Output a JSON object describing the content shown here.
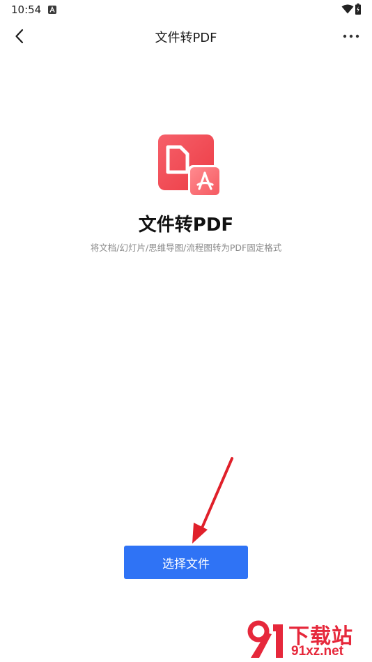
{
  "status_bar": {
    "time": "10:54"
  },
  "app_bar": {
    "title": "文件转PDF"
  },
  "hero": {
    "title": "文件转PDF",
    "subtitle": "将文档/幻灯片/思维导图/流程图转为PDF固定格式"
  },
  "actions": {
    "select_file_label": "选择文件"
  },
  "watermark": {
    "title": "下载站",
    "domain": "91xz.net"
  },
  "colors": {
    "accent": "#2f73f5",
    "icon_red": "#f04a50",
    "annotation_red": "#e0202a"
  }
}
